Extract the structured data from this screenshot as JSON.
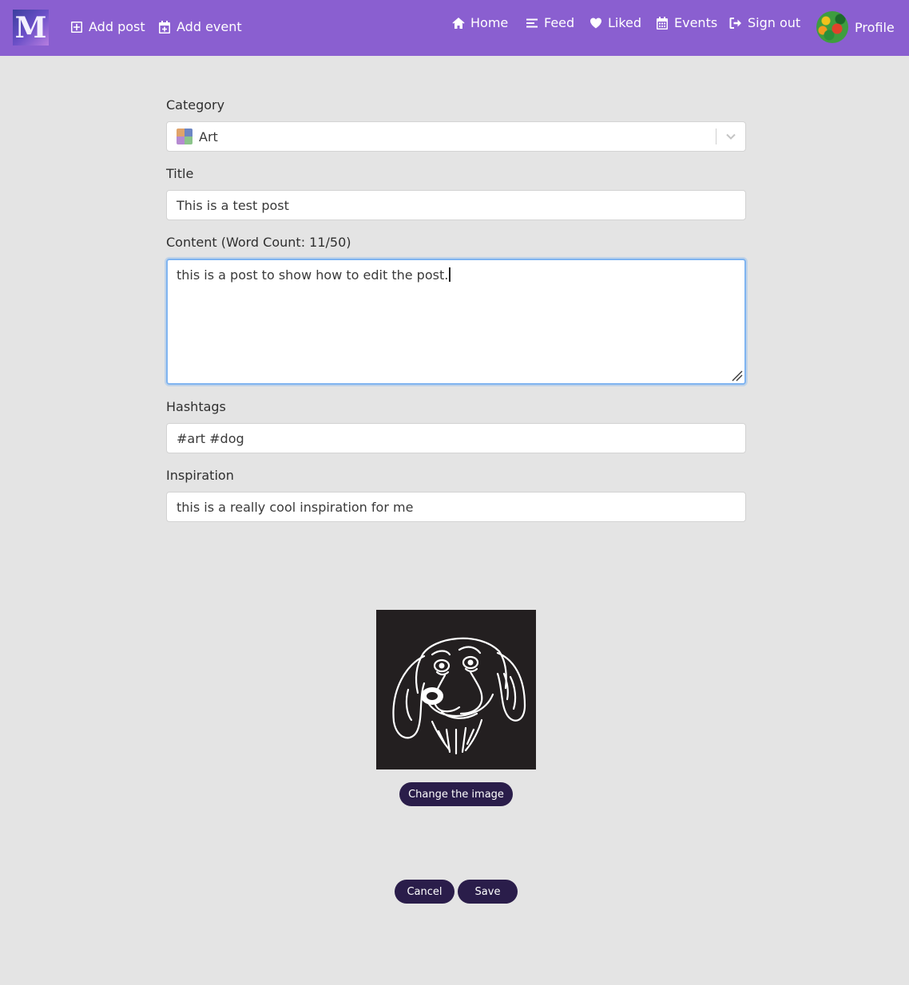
{
  "nav": {
    "add_post": "Add post",
    "add_event": "Add event",
    "home": "Home",
    "feed": "Feed",
    "liked": "Liked",
    "events": "Events",
    "sign_out": "Sign out",
    "profile": "Profile"
  },
  "form": {
    "category_label": "Category",
    "category_value": "Art",
    "title_label": "Title",
    "title_value": "This is a test post",
    "content_label": "Content (Word Count: 11/50)",
    "content_value": "this is a post to show how to edit the post.",
    "hashtags_label": "Hashtags",
    "hashtags_value": "#art #dog",
    "inspiration_label": "Inspiration",
    "inspiration_value": "this is a really cool inspiration for me"
  },
  "image": {
    "change_label": "Change the image"
  },
  "actions": {
    "cancel_label": "Cancel",
    "save_label": "Save"
  },
  "colors": {
    "navbar": "#8a5fd0",
    "page_background": "#e4e4e4",
    "button": "#2a1d4a",
    "focus_ring": "#7fb4f0"
  }
}
